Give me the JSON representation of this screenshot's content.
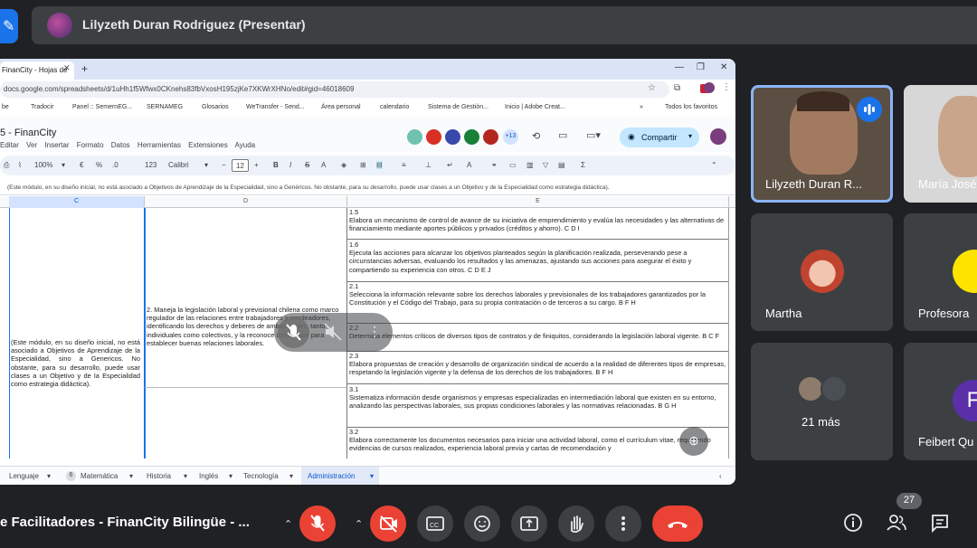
{
  "presenter": {
    "name": "Lilyzeth Duran Rodriguez (Presentar)"
  },
  "browser": {
    "tab_title": "FinanCity - Hojas de",
    "url": "docs.google.com/spreadsheets/d/1uHh1f5Wfwx0CKnehs83fbVxosH195zjKe7XKWrXHNo/edit#gid=46018609",
    "bookmarks": [
      "be",
      "Tradocir",
      "Panel :: SemernEG...",
      "SERNAMEG",
      "Glosarios",
      "WeTransfer - Send...",
      "Área personal",
      "calendario",
      "Sistema de Gestión...",
      "Inicio | Adobe Creat...",
      "Todos los favoritos"
    ]
  },
  "sheets": {
    "title": "5 - FinanCity",
    "menus": [
      "Editar",
      "Ver",
      "Insertar",
      "Formato",
      "Datos",
      "Herramientas",
      "Extensiones",
      "Ayuda"
    ],
    "collab_count": "+13",
    "share_label": "Compartir",
    "zoom": "100%",
    "currency": "€",
    "percent": "%",
    "decimals": ".0",
    "format_123": "123",
    "font": "Calibri",
    "font_size": "12",
    "formula": "(Este módulo, en su diseño inicial, no está asociado a Objetivos de Aprendizaje de la Especialidad, sino a Genéricos. No obstante, para su desarrollo, puede usar clases a un Objetivo y de la Especialidad como estrategia didáctica).",
    "columns": [
      "C",
      "D",
      "E"
    ],
    "col_c_text": "(Este módulo, en su diseño inicial, no está asociado a Objetivos de Aprendizaje de la Especialidad, sino a Genericos. No obstante, para su desarrollo, puede usar clases a un Objetivo y de la Especialidad como estrategia didáctica).",
    "col_d_text": "2. Maneja la legislación laboral y previsional chilena como marco regulador de las relaciones entre trabajadores y empleadores, identificando los derechos y deberes de ambas partes, tanto individuales como colectivos, y la reconoce como base para establecer buenas relaciones laborales.",
    "rows_e": [
      "1.5\nElabora un mecanismo de control de avance de su iniciativa de emprendimiento y evalúa las necesidades y las alternativas de financiamiento mediante aportes públicos y privados (créditos y ahorro). C D I",
      "1.6\nEjecuta las acciones para alcanzar los objetivos planteados según la planificación realizada, perseverando pese a circunstancias adversas, evaluando los resultados y las amenazas, ajustando sus acciones para asegurar el éxito y compartiendo su experiencia con otros. C D E J",
      "2.1\nSelecciona la información relevante sobre los derechos laborales y previsionales de los trabajadores garantizados por la Constitución y el Código del Trabajo, para su propia contratación o de terceros a su cargo. B F H",
      "2.2\nDetermina elementos críticos de diversos tipos de contratos y de finiquitos, considerando la legislación laboral vigente. B C F",
      "2.3\nElabora propuestas de creación y desarrollo de organización sindical de acuerdo a la realidad de diferentes tipos de empresas, respetando la legislación vigente y la defensa de los derechos de los trabajadores. B F H",
      "3.1\nSistematiza información desde organismos y empresas especializadas en intermediación laboral que existen en su entorno, analizando las perspectivas laborales, sus propias condiciones laborales y las normativas relacionadas. B G H",
      "3.2\nElabora correctamente los documentos necesarios para iniciar una actividad laboral, como el currículum vitae, requiriendo evidencias de cursos realizados, experiencia laboral previa y cartas de recomendación y"
    ],
    "sheet_tabs": [
      "Lenguaje",
      "Matemática",
      "Historia",
      "Inglés",
      "Tecnología",
      "Administración"
    ],
    "matematica_badge": "6",
    "active_tab": "Administración"
  },
  "participants": [
    {
      "name": "Lilyzeth Duran R...",
      "active_speaker": true
    },
    {
      "name": "María José"
    },
    {
      "name": "Martha"
    },
    {
      "name": "Profesora"
    },
    {
      "name": "21 más"
    },
    {
      "name": "Feibert Qu",
      "initial": "F"
    }
  ],
  "meeting": {
    "title": "e Facilitadores - FinanCity Bilingüe - ...",
    "people_count": "27"
  },
  "colors": {
    "accent": "#1a73e8",
    "danger": "#ea4335",
    "panel": "#3c4043",
    "background": "#202124"
  }
}
